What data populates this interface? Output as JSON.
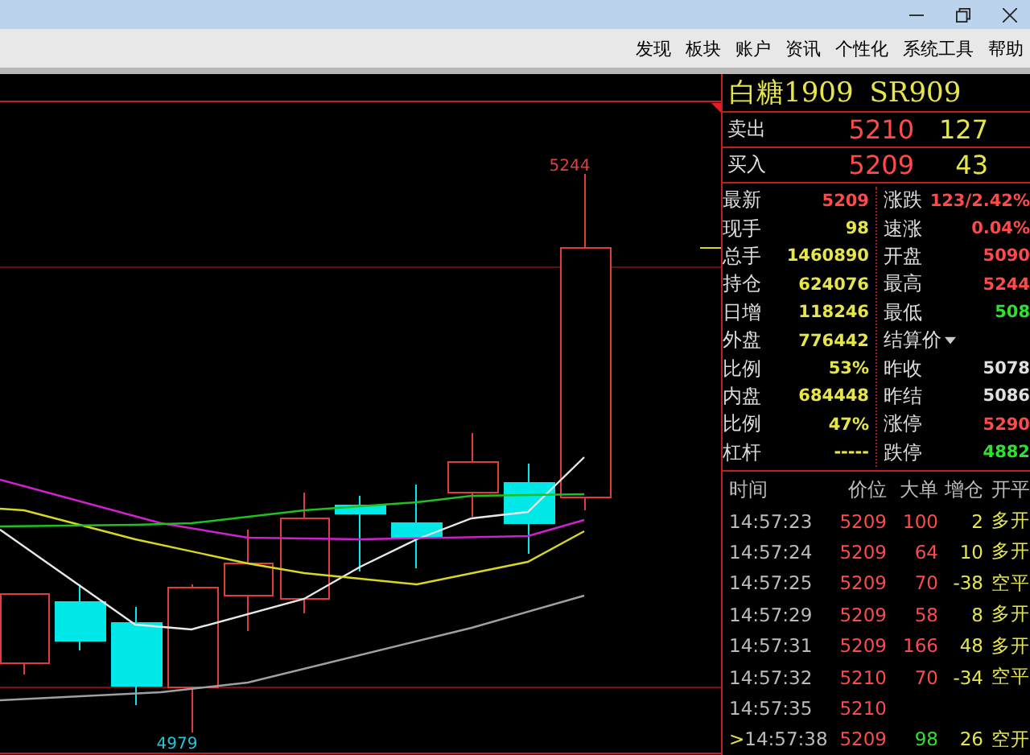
{
  "menu": [
    "发现",
    "板块",
    "账户",
    "资讯",
    "个性化",
    "系统工具",
    "帮助"
  ],
  "chart": {
    "high_label": "5244",
    "low_label": "4979"
  },
  "contract": {
    "name": "白糖1909",
    "code": "SR909"
  },
  "order_book": [
    {
      "label": "卖出",
      "price": "5210",
      "volume": "127"
    },
    {
      "label": "买入",
      "price": "5209",
      "volume": "43"
    }
  ],
  "quote_left": [
    {
      "label": "最新",
      "value": "5209",
      "color": "#ff4a4a"
    },
    {
      "label": "现手",
      "value": "98",
      "color": "#e6e64a"
    },
    {
      "label": "总手",
      "value": "1460890",
      "color": "#e6e64a"
    },
    {
      "label": "持仓",
      "value": "624076",
      "color": "#e6e64a"
    },
    {
      "label": "日增",
      "value": "118246",
      "color": "#e6e64a"
    },
    {
      "label": "外盘",
      "value": "776442",
      "color": "#e6e64a"
    },
    {
      "label": "比例",
      "value": "53%",
      "color": "#e6e64a"
    },
    {
      "label": "内盘",
      "value": "684448",
      "color": "#e6e64a"
    },
    {
      "label": "比例",
      "value": "47%",
      "color": "#e6e64a"
    },
    {
      "label": "杠杆",
      "value": "-----",
      "color": "#e6e64a"
    }
  ],
  "quote_right": [
    {
      "label": "涨跌",
      "value": "123/2.42%",
      "color": "#ff4a4a"
    },
    {
      "label": "速涨",
      "value": "0.04%",
      "color": "#ff4a4a"
    },
    {
      "label": "开盘",
      "value": "5090",
      "color": "#ff4a4a"
    },
    {
      "label": "最高",
      "value": "5244",
      "color": "#ff4a4a"
    },
    {
      "label": "最低",
      "value": "508",
      "color": "#30e030"
    },
    {
      "label": "结算价",
      "dropdown": true
    },
    {
      "label": "昨收",
      "value": "5078",
      "color": "#e0e0e0"
    },
    {
      "label": "昨结",
      "value": "5086",
      "color": "#e0e0e0"
    },
    {
      "label": "涨停",
      "value": "5290",
      "color": "#ff4a4a"
    },
    {
      "label": "跌停",
      "value": "4882",
      "color": "#30e030"
    }
  ],
  "trades": {
    "columns": [
      "时间",
      "价位",
      "大单",
      "增仓",
      "开平"
    ],
    "rows": [
      {
        "time": "14:57:23",
        "price": "5209",
        "big": "100",
        "change": "2",
        "type": "多开",
        "color": "#ff4a4a"
      },
      {
        "time": "14:57:24",
        "price": "5209",
        "big": "64",
        "change": "10",
        "type": "多开",
        "color": "#ff4a4a"
      },
      {
        "time": "14:57:25",
        "price": "5209",
        "big": "70",
        "change": "-38",
        "type": "空平",
        "color": "#ff4a4a"
      },
      {
        "time": "14:57:29",
        "price": "5209",
        "big": "58",
        "change": "8",
        "type": "多开",
        "color": "#ff4a4a"
      },
      {
        "time": "14:57:31",
        "price": "5209",
        "big": "166",
        "change": "48",
        "type": "多开",
        "color": "#ff4a4a"
      },
      {
        "time": "14:57:32",
        "price": "5210",
        "big": "70",
        "change": "-34",
        "type": "空平",
        "color": "#ff4a4a"
      },
      {
        "time": "14:57:35",
        "price": "5210"
      },
      {
        "marker": ">",
        "time": "14:57:38",
        "price": "5209",
        "big": "98",
        "change": "26",
        "type": "空开",
        "color": "#30e030"
      }
    ]
  }
}
